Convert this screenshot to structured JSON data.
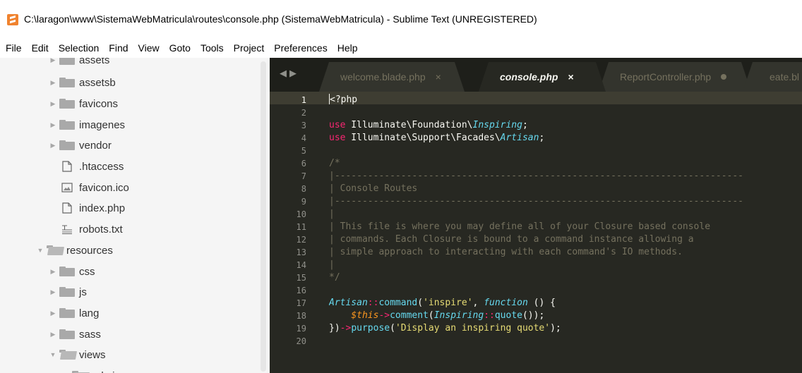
{
  "window": {
    "title": "C:\\laragon\\www\\SistemaWebMatricula\\routes\\console.php (SistemaWebMatricula) - Sublime Text (UNREGISTERED)",
    "app_icon": "sublime-text-icon"
  },
  "menu": {
    "items": [
      "File",
      "Edit",
      "Selection",
      "Find",
      "View",
      "Goto",
      "Tools",
      "Project",
      "Preferences",
      "Help"
    ]
  },
  "sidebar": {
    "items": [
      {
        "label": "assets",
        "kind": "folder",
        "state": "collapsed"
      },
      {
        "label": "assetsb",
        "kind": "folder",
        "state": "collapsed"
      },
      {
        "label": "favicons",
        "kind": "folder",
        "state": "collapsed"
      },
      {
        "label": "imagenes",
        "kind": "folder",
        "state": "collapsed"
      },
      {
        "label": "vendor",
        "kind": "folder",
        "state": "collapsed"
      },
      {
        "label": ".htaccess",
        "kind": "file",
        "icon": "file-icon"
      },
      {
        "label": "favicon.ico",
        "kind": "file",
        "icon": "image-file-icon"
      },
      {
        "label": "index.php",
        "kind": "file",
        "icon": "file-icon"
      },
      {
        "label": "robots.txt",
        "kind": "file",
        "icon": "text-file-icon"
      },
      {
        "label": "resources",
        "kind": "folder",
        "state": "expanded"
      },
      {
        "label": "css",
        "kind": "folder",
        "state": "collapsed"
      },
      {
        "label": "js",
        "kind": "folder",
        "state": "collapsed"
      },
      {
        "label": "lang",
        "kind": "folder",
        "state": "collapsed"
      },
      {
        "label": "sass",
        "kind": "folder",
        "state": "collapsed"
      },
      {
        "label": "views",
        "kind": "folder",
        "state": "expanded"
      },
      {
        "label": "admin",
        "kind": "folder",
        "state": "expanded"
      }
    ]
  },
  "tabs": [
    {
      "label": "welcome.blade.php",
      "active": false,
      "close": "×"
    },
    {
      "label": "console.php",
      "active": true,
      "close": "×"
    },
    {
      "label": "ReportController.php",
      "active": false,
      "dirty": true
    },
    {
      "label": "eate.bl",
      "active": false
    }
  ],
  "editor": {
    "current_line": 1,
    "line_numbers": [
      "1",
      "2",
      "3",
      "4",
      "5",
      "6",
      "7",
      "8",
      "9",
      "10",
      "11",
      "12",
      "13",
      "14",
      "15",
      "16",
      "17",
      "18",
      "19",
      "20"
    ],
    "lines": [
      {
        "tokens": [
          {
            "t": "<?php",
            "c": "ns"
          }
        ]
      },
      {
        "tokens": []
      },
      {
        "tokens": [
          {
            "t": "use",
            "c": "kw"
          },
          {
            "t": " Illuminate\\Foundation\\",
            "c": "ns"
          },
          {
            "t": "Inspiring",
            "c": "cls"
          },
          {
            "t": ";",
            "c": "ns"
          }
        ]
      },
      {
        "tokens": [
          {
            "t": "use",
            "c": "kw"
          },
          {
            "t": " Illuminate\\Support\\Facades\\",
            "c": "ns"
          },
          {
            "t": "Artisan",
            "c": "cls"
          },
          {
            "t": ";",
            "c": "ns"
          }
        ]
      },
      {
        "tokens": []
      },
      {
        "tokens": [
          {
            "t": "/*",
            "c": "cm"
          }
        ]
      },
      {
        "tokens": [
          {
            "t": "|--------------------------------------------------------------------------",
            "c": "cm"
          }
        ]
      },
      {
        "tokens": [
          {
            "t": "| Console Routes",
            "c": "cm"
          }
        ]
      },
      {
        "tokens": [
          {
            "t": "|--------------------------------------------------------------------------",
            "c": "cm"
          }
        ]
      },
      {
        "tokens": [
          {
            "t": "|",
            "c": "cm"
          }
        ]
      },
      {
        "tokens": [
          {
            "t": "| This file is where you may define all of your Closure based console",
            "c": "cm"
          }
        ]
      },
      {
        "tokens": [
          {
            "t": "| commands. Each Closure is bound to a command instance allowing a",
            "c": "cm"
          }
        ]
      },
      {
        "tokens": [
          {
            "t": "| simple approach to interacting with each command's IO methods.",
            "c": "cm"
          }
        ]
      },
      {
        "tokens": [
          {
            "t": "|",
            "c": "cm"
          }
        ]
      },
      {
        "tokens": [
          {
            "t": "*/",
            "c": "cm"
          }
        ]
      },
      {
        "tokens": []
      },
      {
        "tokens": [
          {
            "t": "Artisan",
            "c": "cls"
          },
          {
            "t": "::",
            "c": "op"
          },
          {
            "t": "command",
            "c": "fn"
          },
          {
            "t": "(",
            "c": "ns"
          },
          {
            "t": "'inspire'",
            "c": "str"
          },
          {
            "t": ", ",
            "c": "ns"
          },
          {
            "t": "function",
            "c": "cls"
          },
          {
            "t": " () {",
            "c": "ns"
          }
        ]
      },
      {
        "tokens": [
          {
            "t": "    ",
            "c": "ns"
          },
          {
            "t": "$this",
            "c": "var"
          },
          {
            "t": "->",
            "c": "op"
          },
          {
            "t": "comment",
            "c": "fn"
          },
          {
            "t": "(",
            "c": "ns"
          },
          {
            "t": "Inspiring",
            "c": "cls"
          },
          {
            "t": "::",
            "c": "op"
          },
          {
            "t": "quote",
            "c": "fn"
          },
          {
            "t": "());",
            "c": "ns"
          }
        ]
      },
      {
        "tokens": [
          {
            "t": "})",
            "c": "ns"
          },
          {
            "t": "->",
            "c": "op"
          },
          {
            "t": "purpose",
            "c": "fn"
          },
          {
            "t": "(",
            "c": "ns"
          },
          {
            "t": "'Display an inspiring quote'",
            "c": "str"
          },
          {
            "t": ");",
            "c": "ns"
          }
        ]
      },
      {
        "tokens": []
      }
    ]
  },
  "colors": {
    "editor_bg": "#272822",
    "keyword": "#f92672",
    "class": "#66d9ef",
    "comment": "#75715e",
    "string": "#e6db74",
    "variable": "#fd971f"
  }
}
